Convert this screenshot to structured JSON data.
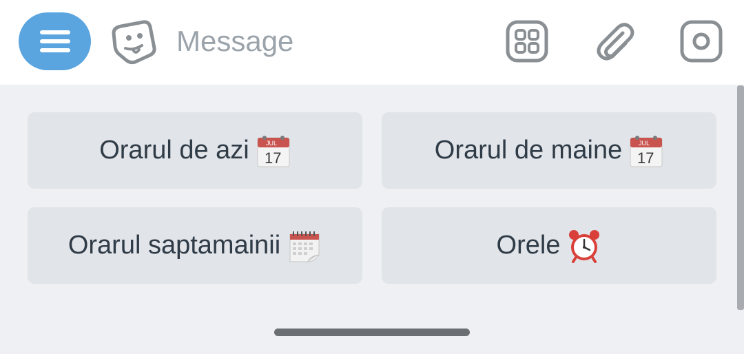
{
  "input_bar": {
    "menu_icon": "hamburger-menu-icon",
    "sticker_icon": "sticker-smiley-icon",
    "message_placeholder": "Message",
    "message_value": "",
    "apps_icon": "grid-apps-icon",
    "attach_icon": "paperclip-icon",
    "camera_icon": "camera-icon"
  },
  "keyboard": {
    "buttons": [
      {
        "label": "Orarul de azi",
        "emoji": "calendar-jul-17-emoji"
      },
      {
        "label": "Orarul de maine",
        "emoji": "calendar-jul-17-emoji"
      },
      {
        "label": "Orarul saptamainii",
        "emoji": "spiral-calendar-emoji"
      },
      {
        "label": "Orele",
        "emoji": "alarm-clock-emoji"
      }
    ]
  },
  "colors": {
    "menu_button": "#5aa5e0",
    "keyboard_background": "#eef0f3",
    "key_background": "#e1e4e8",
    "key_text": "#2f3b46",
    "placeholder_text": "#9ba3ab",
    "icon_gray": "#8a8f94"
  }
}
